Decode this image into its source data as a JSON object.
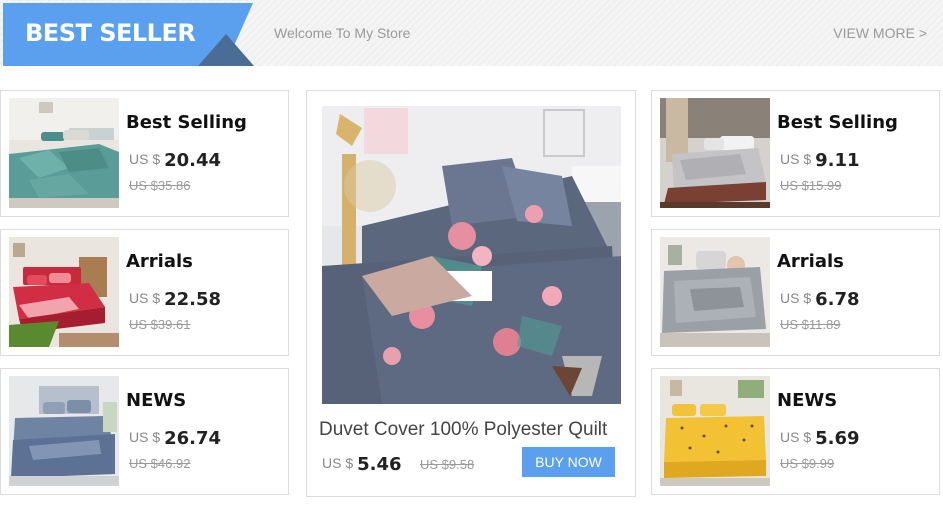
{
  "header": {
    "banner_title": "BEST SELLER",
    "welcome": "Welcome To My Store",
    "view_more": "VIEW MORE >",
    "accent_color": "#5aa0ee",
    "fold_color": "#4a6d97"
  },
  "left_cards": [
    {
      "title": "Best Selling",
      "currency": "US $",
      "price": "20.44",
      "old_price": "US $35.86",
      "image": "teal-geometric-bedding-photo"
    },
    {
      "title": "Arrials",
      "currency": "US $",
      "price": "22.58",
      "old_price": "US $39.61",
      "image": "red-bedding-photo"
    },
    {
      "title": "NEWS",
      "currency": "US $",
      "price": "26.74",
      "old_price": "US $46.92",
      "image": "blue-grey-bedding-photo"
    }
  ],
  "featured": {
    "title": "Duvet Cover 100% Polyester Quilt",
    "currency": "US $",
    "price": "5.46",
    "old_price": "US $9.58",
    "button": "BUY NOW",
    "image": "grey-floral-duvet-photo"
  },
  "right_cards": [
    {
      "title": "Best Selling",
      "currency": "US $",
      "price": "9.11",
      "old_price": "US $15.99",
      "image": "grey-throw-blanket-photo"
    },
    {
      "title": "Arrials",
      "currency": "US $",
      "price": "6.78",
      "old_price": "US $11.89",
      "image": "grey-plush-blanket-photo"
    },
    {
      "title": "NEWS",
      "currency": "US $",
      "price": "5.69",
      "old_price": "US $9.99",
      "image": "yellow-dotted-sheet-photo"
    }
  ]
}
